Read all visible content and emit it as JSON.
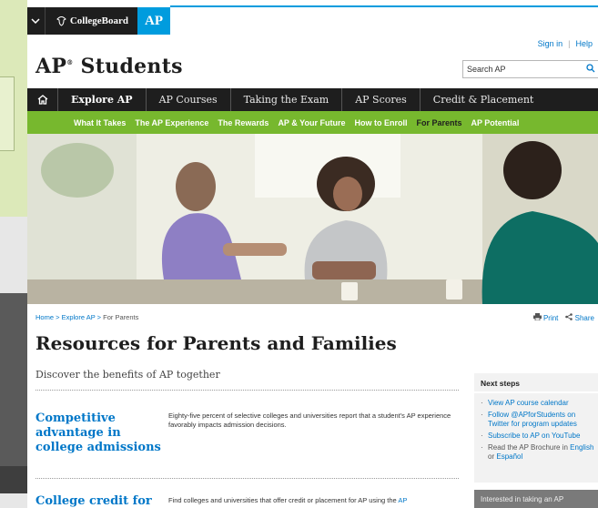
{
  "collegeboard": {
    "logo": "CollegeBoard",
    "ap_badge": "AP"
  },
  "header": {
    "sign_in": "Sign in",
    "help": "Help",
    "site_title": "AP",
    "site_title_rest": "Students",
    "registered_mark": "®",
    "search_placeholder": "Search AP"
  },
  "main_nav": [
    "Explore AP",
    "AP Courses",
    "Taking the Exam",
    "AP Scores",
    "Credit & Placement"
  ],
  "sub_nav": [
    "What It Takes",
    "The AP Experience",
    "The Rewards",
    "AP & Your Future",
    "How to Enroll",
    "For Parents",
    "AP Potential"
  ],
  "breadcrumb": {
    "home": "Home",
    "sep": ">",
    "explore": "Explore AP",
    "current": "For Parents"
  },
  "tools": {
    "print": "Print",
    "share": "Share"
  },
  "page": {
    "title": "Resources for Parents and Families",
    "subtitle": "Discover the benefits of AP together"
  },
  "sections": [
    {
      "title": "Competitive advantage in college admissions",
      "body": "Eighty-five percent of selective colleges and universities report that a student's AP experience favorably impacts admission decisions."
    },
    {
      "title": "College credit for",
      "body": "Find colleges and universities that offer credit or placement for AP using the",
      "link": "AP"
    }
  ],
  "next_steps": {
    "heading": "Next steps",
    "items": [
      {
        "text": "View AP course calendar"
      },
      {
        "text": "Follow @APforStudents on Twitter for program updates"
      },
      {
        "text": "Subscribe to AP on YouTube"
      },
      {
        "prefix": "Read the AP Brochure in",
        "link1": "English",
        "mid": "or",
        "link2": "Español"
      }
    ]
  },
  "interested": "Interested in taking an AP"
}
